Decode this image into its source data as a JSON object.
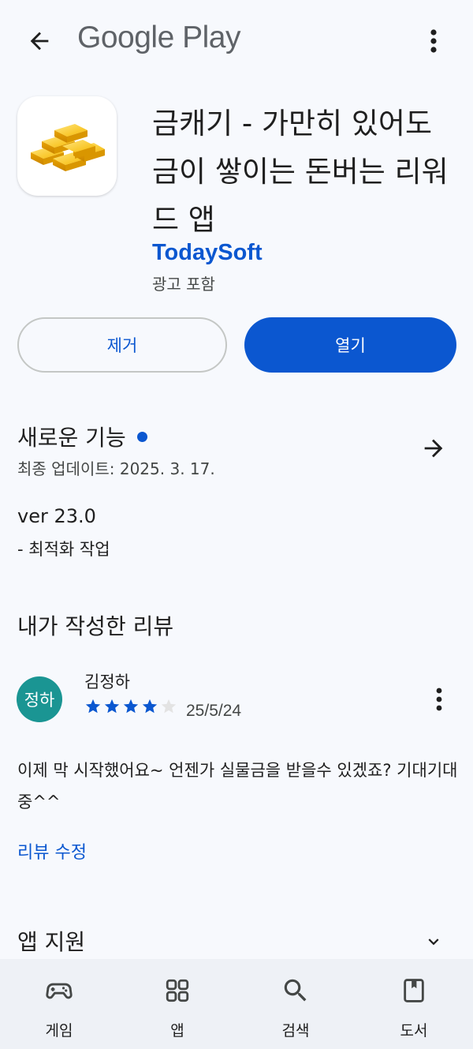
{
  "header": {
    "brand": "Google Play",
    "back_icon": "arrow-back-icon",
    "more_icon": "more-vert-icon"
  },
  "app": {
    "icon": "gold-bars-icon",
    "title": "금캐기 - 가만히 있어도 금이 쌓이는 돈버는 리워드 앱",
    "developer": "TodaySoft",
    "ads_note": "광고 포함"
  },
  "actions": {
    "remove_label": "제거",
    "open_label": "열기"
  },
  "whats_new": {
    "title": "새로운 기능",
    "last_updated": "최종 업데이트: 2025. 3. 17.",
    "version": "ver 23.0",
    "detail": "- 최적화 작업"
  },
  "my_review": {
    "title": "내가 작성한 리뷰",
    "avatar_text": "정하",
    "reviewer": "김정하",
    "rating": 4,
    "max_rating": 5,
    "date": "25/5/24",
    "text": "이제 막 시작했어요~ 언젠가 실물금을 받을수 있겠죠? 기대기대중^^",
    "edit_label": "리뷰 수정"
  },
  "support": {
    "title": "앱 지원"
  },
  "bottom_nav": [
    {
      "label": "게임",
      "icon": "gamepad-icon"
    },
    {
      "label": "앱",
      "icon": "apps-grid-icon"
    },
    {
      "label": "검색",
      "icon": "search-icon"
    },
    {
      "label": "도서",
      "icon": "book-icon"
    }
  ],
  "colors": {
    "accent": "#0b57d0",
    "avatar": "#1a9593",
    "background": "#f7f9fd",
    "nav_background": "#eef1f6"
  }
}
